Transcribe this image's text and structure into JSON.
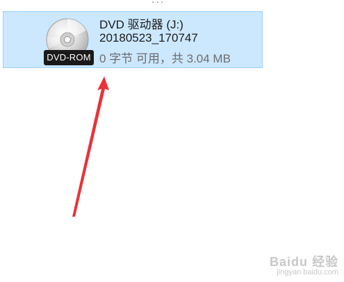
{
  "cut_text": "...",
  "drive": {
    "name": "DVD 驱动器 (J:)",
    "volume_label": "20180523_170747",
    "space": "0 字节 可用，共 3.04 MB",
    "badge": "DVD-ROM",
    "icon": "cd-disc-icon"
  },
  "colors": {
    "selection_bg": "#cce8ff",
    "selection_border": "#99d1ff",
    "arrow": "#e8333a"
  },
  "watermark": {
    "main": "Baidu 经验",
    "sub": "jingyan.baidu.com"
  }
}
